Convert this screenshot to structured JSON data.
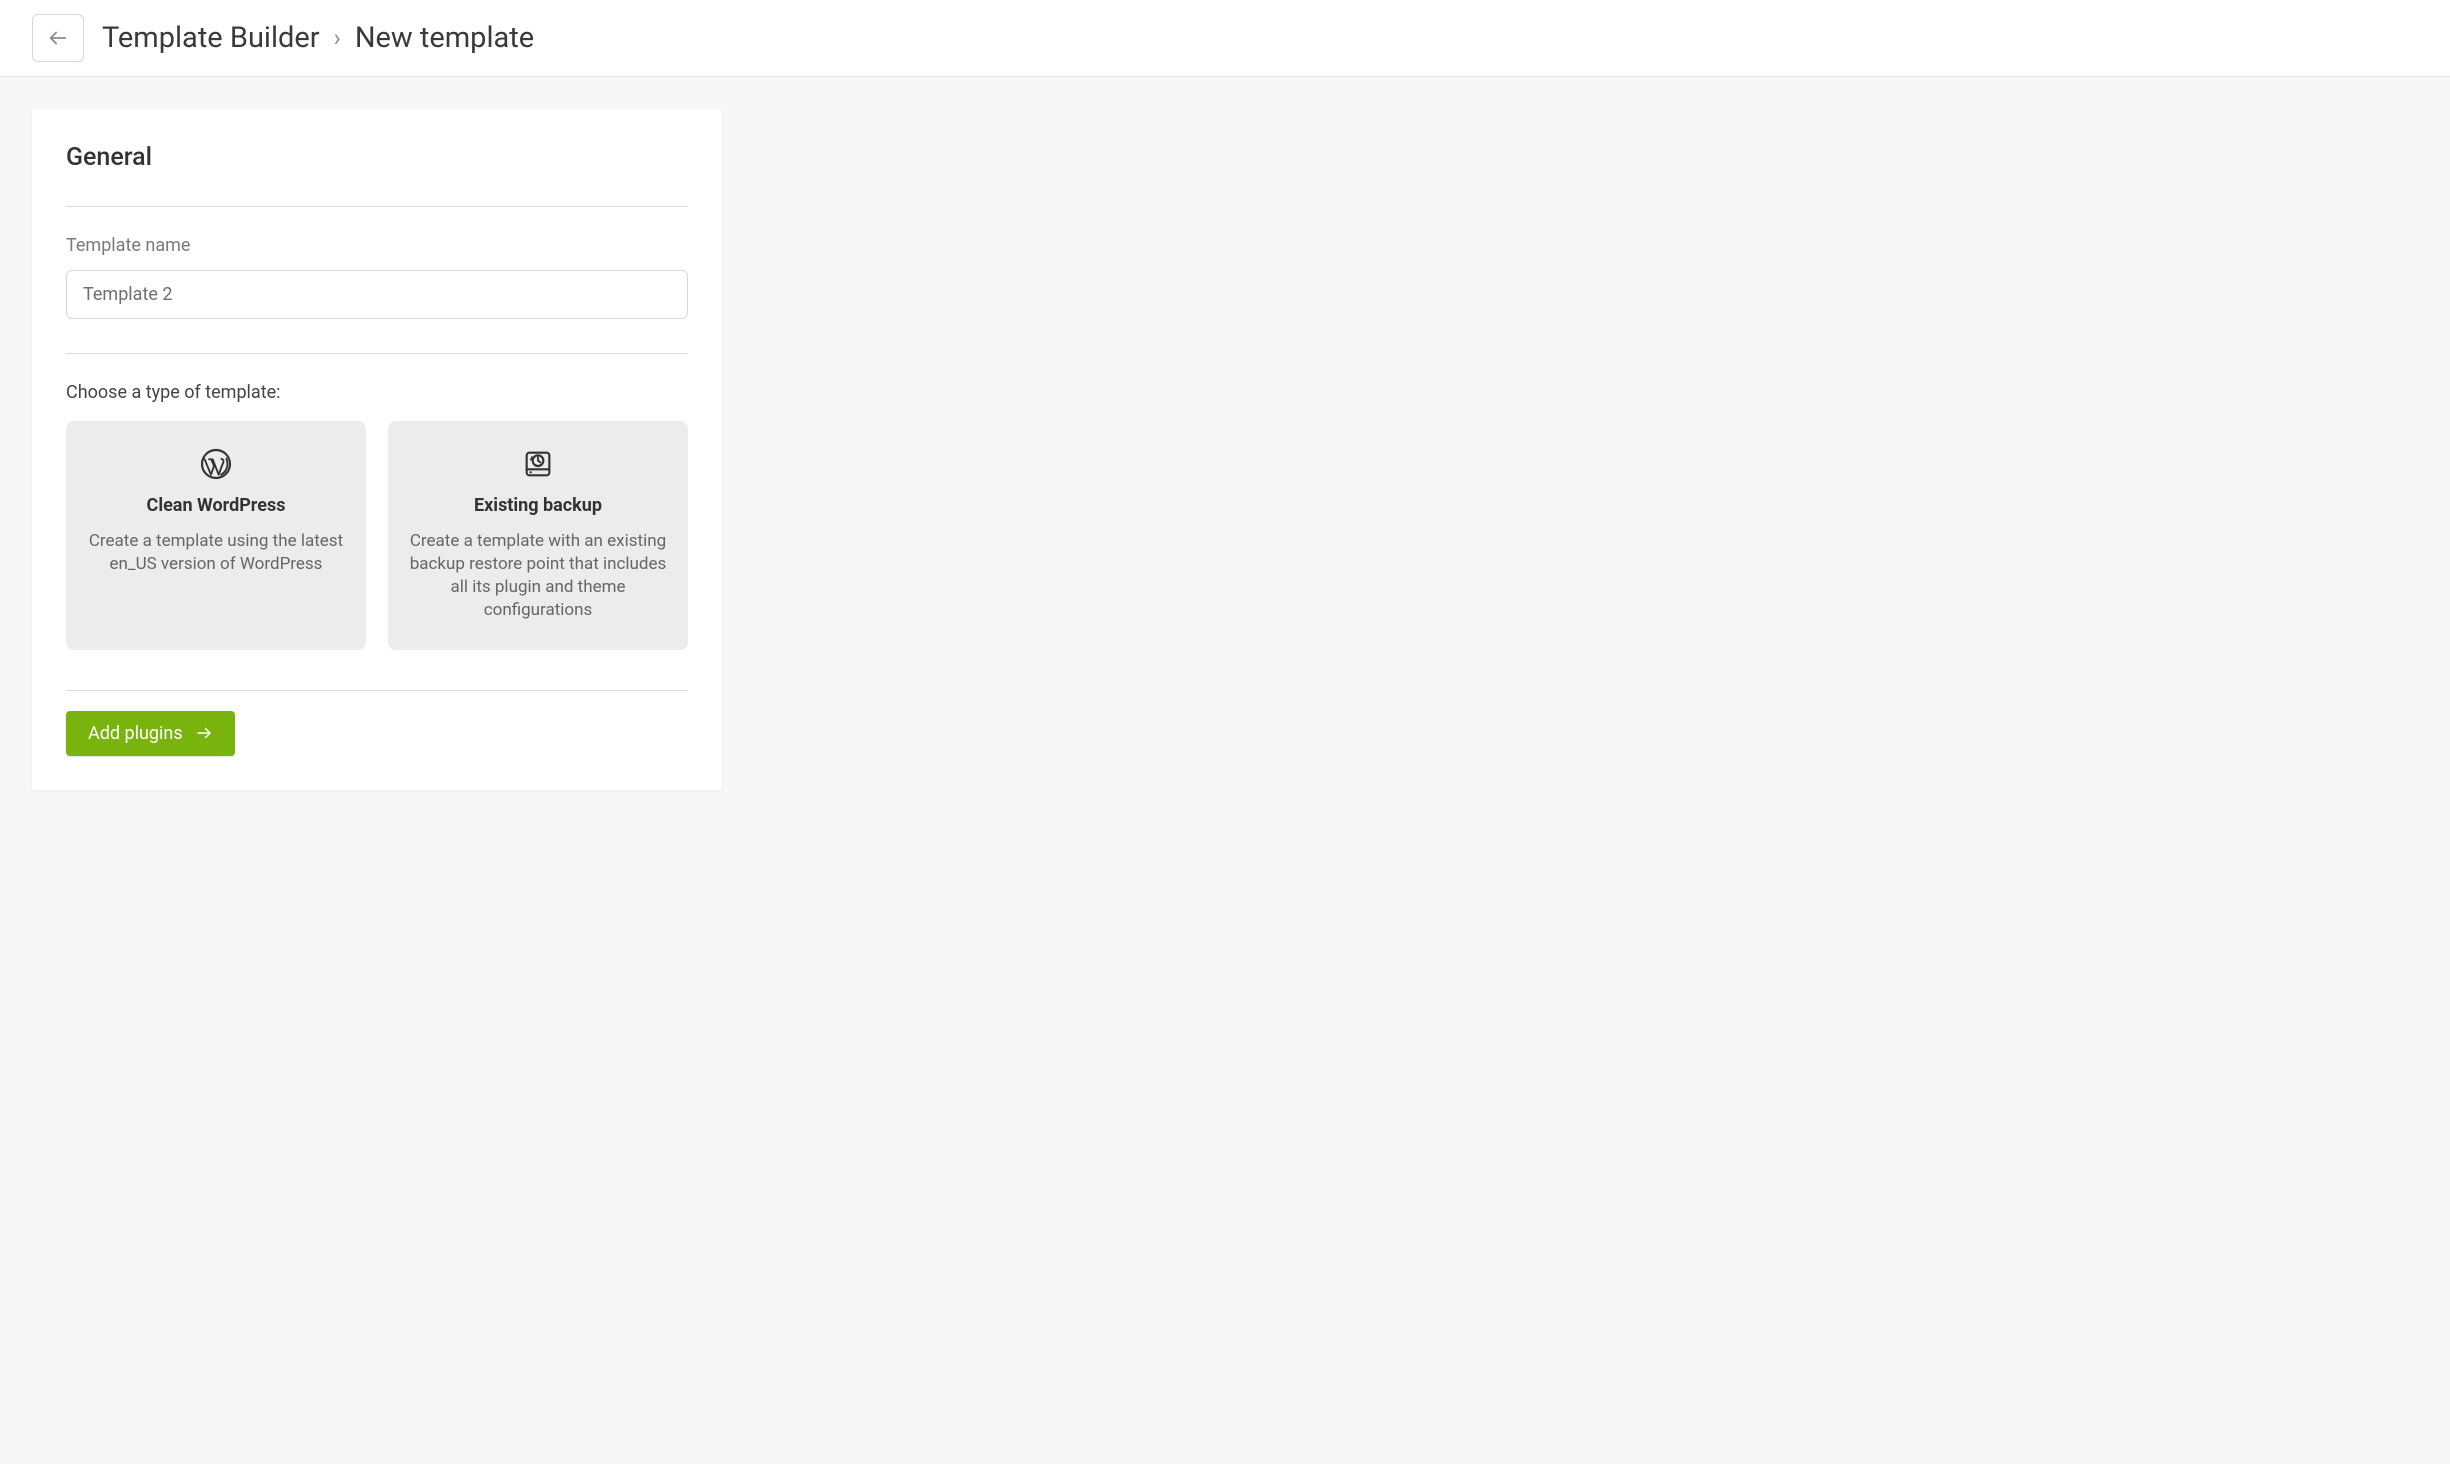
{
  "header": {
    "breadcrumb_root": "Template Builder",
    "breadcrumb_current": "New template"
  },
  "general": {
    "section_title": "General",
    "template_name_label": "Template name",
    "template_name_value": "Template 2",
    "choose_type_label": "Choose a type of template:",
    "options": [
      {
        "title": "Clean WordPress",
        "description": "Create a template using the latest en_US version of WordPress"
      },
      {
        "title": "Existing backup",
        "description": "Create a template with an existing backup restore point that includes all its plugin and theme configurations"
      }
    ],
    "primary_button_label": "Add plugins"
  }
}
